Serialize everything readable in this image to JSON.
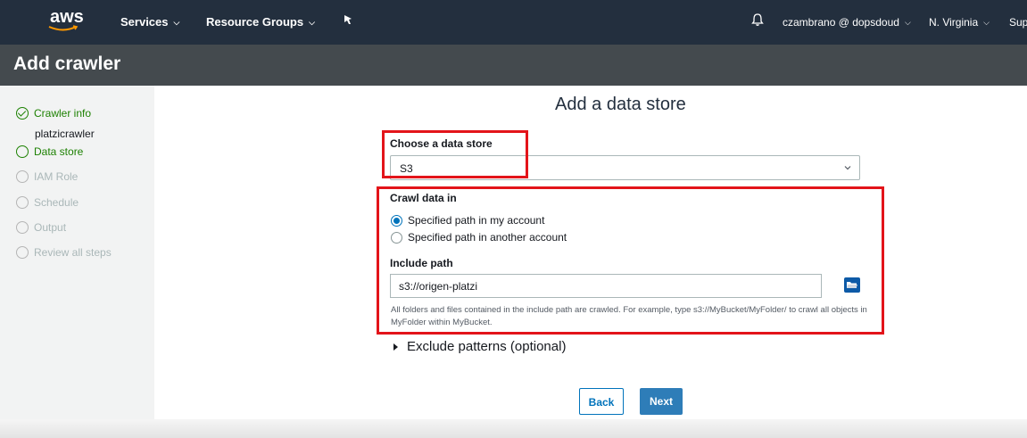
{
  "topbar": {
    "logo": "aws",
    "services": "Services",
    "resource_groups": "Resource Groups",
    "user": "czambrano @ dopsdoud",
    "region": "N. Virginia",
    "support": "Sup"
  },
  "page": {
    "title": "Add crawler"
  },
  "sidebar": {
    "steps": [
      {
        "label": "Crawler info",
        "state": "done",
        "sub": "platzicrawler"
      },
      {
        "label": "Data store",
        "state": "active"
      },
      {
        "label": "IAM Role",
        "state": "disabled"
      },
      {
        "label": "Schedule",
        "state": "disabled"
      },
      {
        "label": "Output",
        "state": "disabled"
      },
      {
        "label": "Review all steps",
        "state": "disabled"
      }
    ]
  },
  "main": {
    "title": "Add a data store",
    "data_store_label": "Choose a data store",
    "data_store_value": "S3",
    "crawl_label": "Crawl data in",
    "crawl_options": [
      {
        "label": "Specified path in my account",
        "checked": true
      },
      {
        "label": "Specified path in another account",
        "checked": false
      }
    ],
    "include_path_label": "Include path",
    "include_path_value": "s3://origen-platzi",
    "include_path_hint": "All folders and files contained in the include path are crawled. For example, type s3://MyBucket/MyFolder/ to crawl all objects in MyFolder within MyBucket.",
    "exclude_label": "Exclude patterns (optional)",
    "back_button": "Back",
    "next_button": "Next"
  },
  "colors": {
    "topbar": "#232f3e",
    "titlebar": "#444a4e",
    "accent_green": "#1d8102",
    "primary_blue": "#0073bb",
    "highlight_red": "#e3141a"
  }
}
